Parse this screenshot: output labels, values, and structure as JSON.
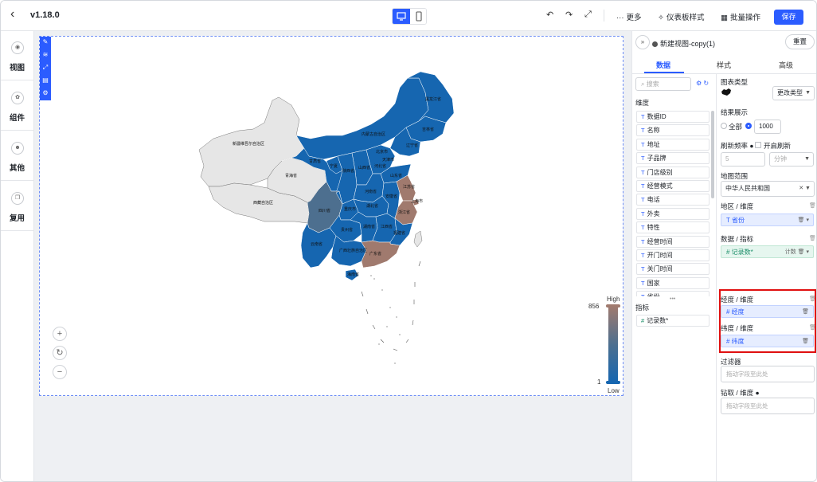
{
  "app": {
    "version": "v1.18.0"
  },
  "toolbar": {
    "more_label": "更多",
    "more_glyph": "···",
    "dashboard_style_label": "仪表板样式",
    "batch_label": "批量操作",
    "save_label": "保存"
  },
  "rail": {
    "items": [
      {
        "label": "视图",
        "icon": "view-icon"
      },
      {
        "label": "组件",
        "icon": "component-icon"
      },
      {
        "label": "其他",
        "icon": "other-icon"
      },
      {
        "label": "复用",
        "icon": "reuse-icon"
      }
    ]
  },
  "map": {
    "provinces": [
      "新疆维吾尔自治区",
      "西藏自治区",
      "青海省",
      "甘肃省",
      "四川省",
      "云南省",
      "内蒙古自治区",
      "黑龙江省",
      "吉林省",
      "辽宁省",
      "北京市",
      "天津市",
      "河北省",
      "山西省",
      "陕西省",
      "宁夏",
      "山东省",
      "河南省",
      "湖北省",
      "重庆市",
      "贵州省",
      "湖南省",
      "江西省",
      "安徽省",
      "江苏省",
      "上海市",
      "浙江省",
      "福建省",
      "广东省",
      "广西壮族自治区",
      "海南省"
    ],
    "legend": {
      "high_label": "High",
      "low_label": "Low",
      "max": "856",
      "min": "1"
    },
    "colors": {
      "high": "#a07a6e",
      "mid": "#4d6f8f",
      "low": "#1666b0",
      "nodata": "#e6e6e6"
    }
  },
  "panel": {
    "view_name": "新建视图-copy(1)",
    "reset_label": "重置",
    "tabs": [
      "数据",
      "样式",
      "高级"
    ],
    "search_placeholder": "搜索",
    "dimension_title": "维度",
    "dimensions": [
      "数据ID",
      "名称",
      "地址",
      "子品牌",
      "门店级别",
      "经营模式",
      "电话",
      "外卖",
      "特性",
      "经营时间",
      "开门时间",
      "关门时间",
      "国家",
      "省份"
    ],
    "metric_title": "指标",
    "metrics": [
      "记录数*"
    ],
    "chart_type_label": "图表类型",
    "change_type_label": "更改类型",
    "result_label": "结果展示",
    "result_all": "全部",
    "result_count": "1000",
    "refresh_label": "刷新频率",
    "auto_refresh_label": "开启刷新",
    "refresh_value": "5",
    "refresh_unit": "分钟",
    "map_range_label": "地图范围",
    "map_range_value": "中华人民共和国",
    "region_label": "地区 / 维度",
    "region_field": "省份",
    "data_label": "数据 / 指标",
    "data_field": "记录数*",
    "data_agg": "计数",
    "lng_label": "经度 / 维度",
    "lng_field": "经度",
    "lat_label": "纬度 / 维度",
    "lat_field": "纬度",
    "filter_label": "过滤器",
    "filter_placeholder": "拖动字段至此处",
    "drill_label": "钻取 / 维度",
    "drill_placeholder": "拖动字段至此处"
  }
}
